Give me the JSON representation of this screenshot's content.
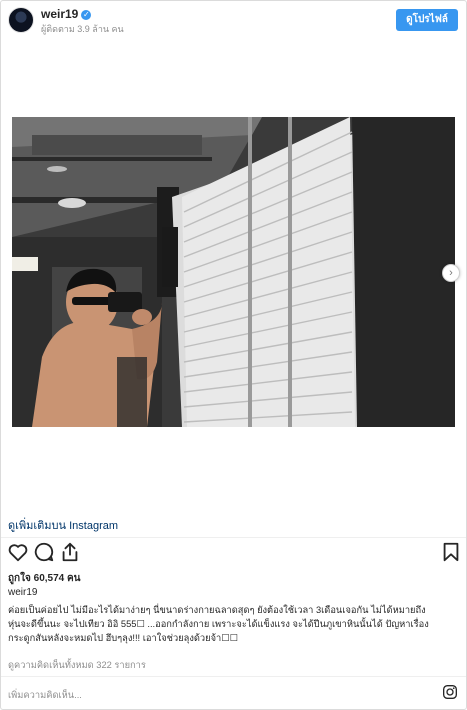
{
  "post": {
    "username": "weir19",
    "verified_mark": "✓",
    "followers": "ผู้ติดตาม 3.9 ล้าน คน",
    "view_profile_label": "ดูโปรไฟล์",
    "more_on_instagram": "ดูเพิ่มเติมบน Instagram",
    "likes": "ถูกใจ 60,574 คน",
    "owner": "weir19",
    "caption_line1": "ค่อยเป็นค่อยไป ไม่มีอะไรได้มาง่ายๆ นี่ขนาดร่างกายฉลาดสุดๆ ยังต้องใช้เวลา 3เดือนเจอกัน ไม่ได้หมายถึง",
    "caption_line2": "หุ่นจะดีขึ้นนะ จะไปเทียว อิอิ 555☐ ...ออกกำลังกาย เพราะจะได้แข็งแรง จะได้ปีนภูเขาหินนั้นได้ ปัญหาเรื่อง",
    "caption_line3": "กระดูกสันหลังจะหมดไป ฮึบๆลุง!!! เอาใจช่วยลุงด้วยจ้า☐☐",
    "view_comments": "ดูความคิดเห็นทั้งหมด 322 รายการ",
    "add_comment_placeholder": "เพิ่มความคิดเห็น..."
  },
  "icons": {
    "like": "heart-outline",
    "comment": "speech-bubble-outline",
    "share": "share-arrow-outline",
    "save": "bookmark-outline",
    "next": "chevron-right",
    "instagram": "instagram-glyph"
  },
  "colors": {
    "accent_blue": "#3897f0",
    "link_navy": "#003569",
    "muted_gray": "#8e8e8e",
    "text": "#262626"
  }
}
